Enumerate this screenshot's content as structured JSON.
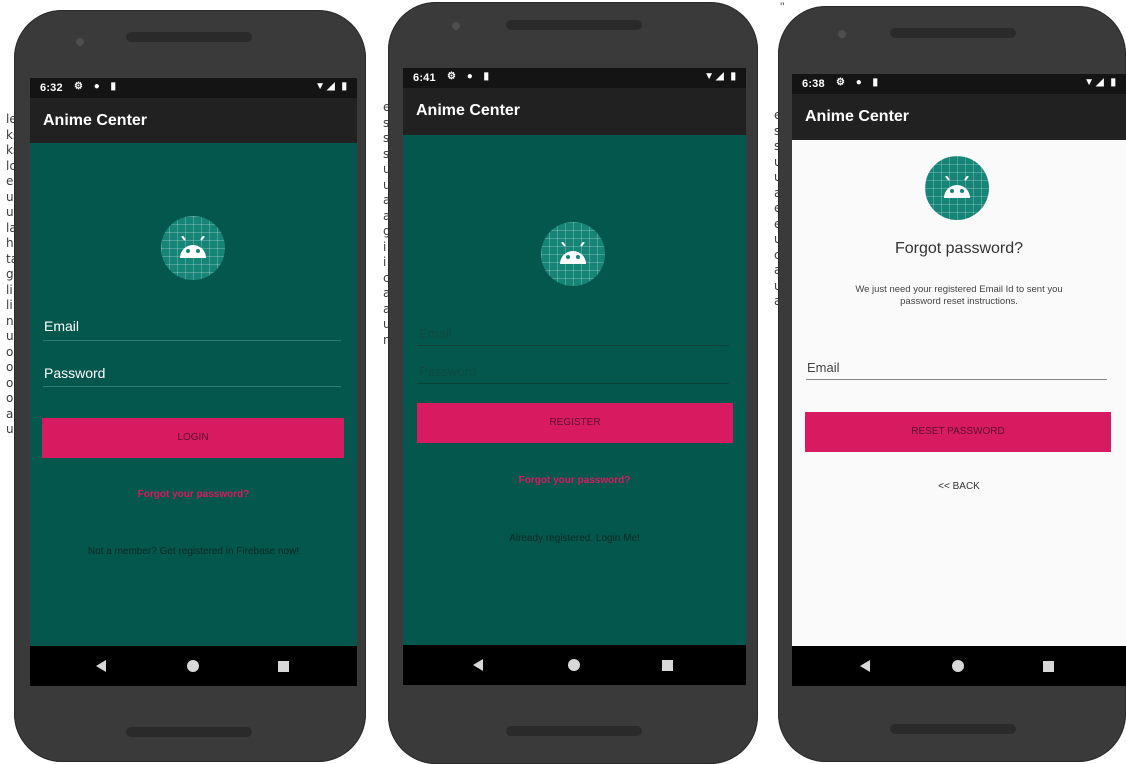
{
  "background": {
    "left_fragments": [
      "le",
      "ks",
      "ks",
      "lc",
      "e",
      "u",
      "u",
      "la",
      "h",
      "ta",
      "g",
      "li",
      "li",
      "nc",
      "u",
      "or",
      "ou",
      "oa",
      "o",
      "al",
      "u"
    ],
    "mid_fragments": [
      "e",
      "s",
      "s",
      "s",
      "u",
      "u",
      "a",
      "a",
      "g",
      "i",
      "i",
      "c",
      "a",
      "a",
      "u",
      "r"
    ],
    "right_fragments": [
      "e",
      "s",
      "s",
      "u",
      "u",
      "a",
      "e",
      "e",
      "u",
      "c",
      "a",
      "u",
      "a"
    ],
    "top_dots": "''"
  },
  "phones": [
    {
      "status": {
        "time": "6:32",
        "left_icons": "⚙ ● ▮",
        "right_icons": "▼◢ ▮"
      },
      "app_title": "Anime Center",
      "screen": "login",
      "fields": {
        "email_label": "Email",
        "password_label": "Password"
      },
      "button": {
        "label": "LOGIN"
      },
      "forgot_link": "Forgot your password?",
      "register_link": "Not a member? Get registered in Firebase now!",
      "nav": {
        "back_icon": "back-triangle-icon",
        "home_icon": "home-circle-icon",
        "recents_icon": "recents-square-icon"
      }
    },
    {
      "status": {
        "time": "6:41",
        "left_icons": "⚙ ● ▮",
        "right_icons": "▼◢ ▮"
      },
      "app_title": "Anime Center",
      "screen": "register",
      "fields": {
        "email_placeholder": "Email",
        "password_placeholder": "Password"
      },
      "button": {
        "label": "REGISTER"
      },
      "forgot_link": "Forgot your password?",
      "login_link": "Already registered. Login Me!",
      "nav": {
        "back_icon": "back-triangle-icon",
        "home_icon": "home-circle-icon",
        "recents_icon": "recents-square-icon"
      }
    },
    {
      "status": {
        "time": "6:38",
        "left_icons": "⚙ ● ▮",
        "right_icons": "▼◢ ▮"
      },
      "app_title": "Anime Center",
      "screen": "forgot-password",
      "heading": "Forgot password?",
      "description_line1": "We just need your registered Email Id to sent you",
      "description_line2": "password reset instructions.",
      "fields": {
        "email_label": "Email"
      },
      "button": {
        "label": "RESET PASSWORD"
      },
      "back_link": "<< BACK",
      "nav": {
        "back_icon": "back-triangle-icon",
        "home_icon": "home-circle-icon",
        "recents_icon": "recents-square-icon"
      }
    }
  ],
  "colors": {
    "login_bg": "#03574c",
    "reset_bg": "#fafafa",
    "accent": "#d81b60",
    "appbar": "#212121",
    "logo": "#168578"
  }
}
